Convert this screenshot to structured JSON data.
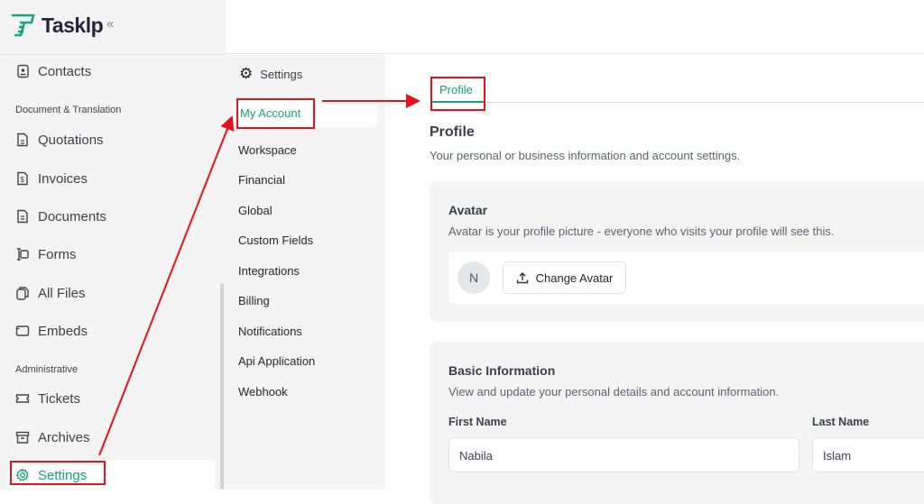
{
  "brand": {
    "name": "Tasklp",
    "color": "#16a37a",
    "collapse_icon": "«"
  },
  "sidebar": {
    "items": [
      {
        "label": "Contacts",
        "icon": "contacts-icon"
      },
      {
        "section": "Document & Translation"
      },
      {
        "label": "Quotations",
        "icon": "quotation-icon"
      },
      {
        "label": "Invoices",
        "icon": "invoice-icon"
      },
      {
        "label": "Documents",
        "icon": "document-icon"
      },
      {
        "label": "Forms",
        "icon": "form-icon"
      },
      {
        "label": "All Files",
        "icon": "files-icon"
      },
      {
        "label": "Embeds",
        "icon": "embed-icon"
      },
      {
        "section": "Administrative"
      },
      {
        "label": "Tickets",
        "icon": "ticket-icon"
      },
      {
        "label": "Archives",
        "icon": "archive-icon"
      },
      {
        "label": "Settings",
        "icon": "gear-icon",
        "active": true
      }
    ]
  },
  "settings_nav": {
    "header": "Settings",
    "items": [
      "My Account",
      "Workspace",
      "Financial",
      "Global",
      "Custom Fields",
      "Integrations",
      "Billing",
      "Notifications",
      "Api Application",
      "Webhook"
    ]
  },
  "main": {
    "tab": "Profile",
    "title": "Profile",
    "subtitle": "Your personal or business information and account settings.",
    "avatar": {
      "title": "Avatar",
      "desc": "Avatar is your profile picture - everyone who visits your profile will see this.",
      "initial": "N",
      "button": "Change Avatar"
    },
    "basic": {
      "title": "Basic Information",
      "desc": "View and update your personal details and account information.",
      "first_label": "First Name",
      "first_value": "Nabila",
      "last_label": "Last Name",
      "last_value": "Islam"
    }
  }
}
